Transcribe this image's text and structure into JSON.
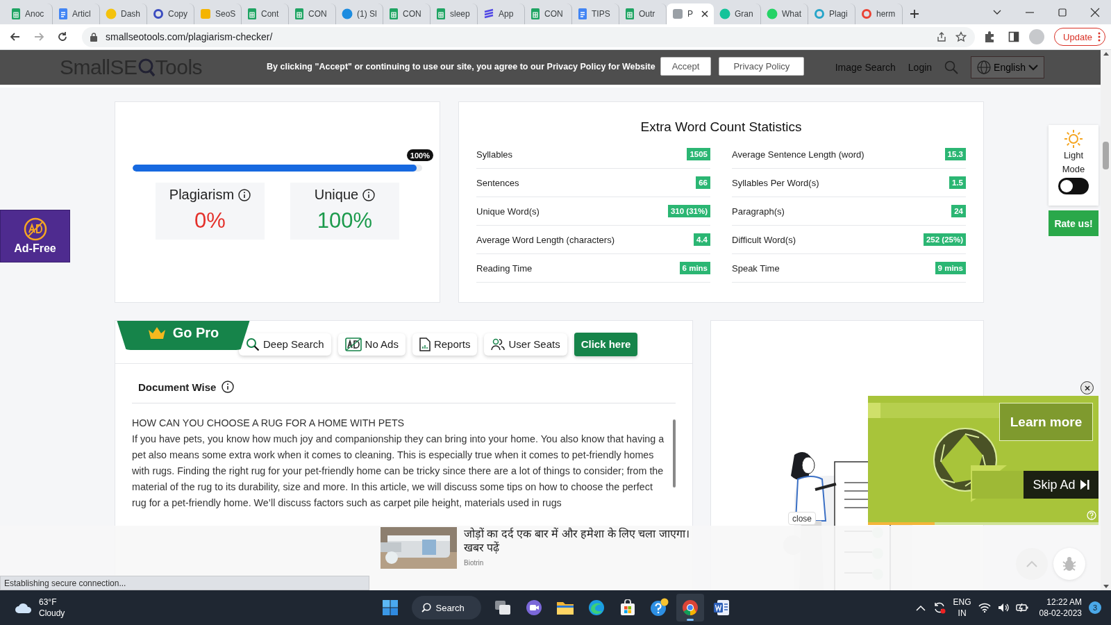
{
  "browser": {
    "tabs": [
      {
        "title": "Anoc",
        "kind": "sheet",
        "color": "#1fa463",
        "selected": false
      },
      {
        "title": "Articl",
        "kind": "doc",
        "color": "#4285f4",
        "selected": false
      },
      {
        "title": "Dash",
        "kind": "round",
        "color": "#f4c20d",
        "selected": false
      },
      {
        "title": "Copy",
        "kind": "ring",
        "color": "#3b4cc0",
        "selected": false
      },
      {
        "title": "SeoS",
        "kind": "square",
        "color": "#f4b400",
        "selected": false
      },
      {
        "title": "Cont",
        "kind": "sheet",
        "color": "#1fa463",
        "selected": false
      },
      {
        "title": "CON",
        "kind": "sheet",
        "color": "#1fa463",
        "selected": false
      },
      {
        "title": "(1) Sl",
        "kind": "round",
        "color": "#1d8ce0",
        "selected": false
      },
      {
        "title": "CON",
        "kind": "sheet",
        "color": "#1fa463",
        "selected": false
      },
      {
        "title": "sleep",
        "kind": "sheet",
        "color": "#1fa463",
        "selected": false
      },
      {
        "title": "App",
        "kind": "stripes",
        "color": "#4f46e5",
        "selected": false
      },
      {
        "title": "CON",
        "kind": "sheet",
        "color": "#1fa463",
        "selected": false
      },
      {
        "title": "TIPS",
        "kind": "doc",
        "color": "#4285f4",
        "selected": false
      },
      {
        "title": "Outr",
        "kind": "sheet",
        "color": "#1fa463",
        "selected": false
      },
      {
        "title": "P",
        "kind": "square",
        "color": "#9aa0a6",
        "selected": true
      },
      {
        "title": "Gran",
        "kind": "round",
        "color": "#15c39a",
        "selected": false
      },
      {
        "title": "What",
        "kind": "round",
        "color": "#25d366",
        "selected": false
      },
      {
        "title": "Plagi",
        "kind": "ring",
        "color": "#26a5c9",
        "selected": false
      },
      {
        "title": "herm",
        "kind": "ring",
        "color": "#ea4335",
        "selected": false
      }
    ],
    "url": "smallseotools.com/plagiarism-checker/",
    "update_button": "Update"
  },
  "header": {
    "logo": {
      "before_icon": "SmallSE",
      "after_icon": "Tools"
    },
    "nav": [
      "Image Search",
      "Login"
    ],
    "language": "English"
  },
  "cookie_banner": {
    "message": "By clicking \"Accept\" or continuing to use our site, you agree to our Privacy Policy for Website",
    "buttons": [
      "Accept",
      "Privacy Policy"
    ]
  },
  "ad_free": "Ad-Free",
  "theme_panel": {
    "label": "Light Mode",
    "on": false
  },
  "rate_button": "Rate us!",
  "score_card": {
    "level": 0.98,
    "badge": "100%",
    "plagiarism": {
      "label": "Plagiarism",
      "value": "0%"
    },
    "unique": {
      "label": "Unique",
      "value": "100%"
    }
  },
  "stats": {
    "title": "Extra Word Count Statistics",
    "columns": [
      [
        {
          "label": "Syllables",
          "value": "1505"
        },
        {
          "label": "Sentences",
          "value": "66"
        },
        {
          "label": "Unique Word(s)",
          "value": "310 (31%)"
        },
        {
          "label": "Average Word Length (characters)",
          "value": "4.4"
        },
        {
          "label": "Reading Time",
          "value": "6 mins"
        }
      ],
      [
        {
          "label": "Average Sentence Length (word)",
          "value": "15.3"
        },
        {
          "label": "Syllables Per Word(s)",
          "value": "1.5"
        },
        {
          "label": "Paragraph(s)",
          "value": "24"
        },
        {
          "label": "Difficult Word(s)",
          "value": "252 (25%)"
        },
        {
          "label": "Speak Time",
          "value": "9 mins"
        }
      ]
    ]
  },
  "pro_bar": {
    "ribbon": "Go Pro",
    "features": [
      {
        "label": "Deep Search",
        "kind": "search"
      },
      {
        "label": "No Ads",
        "kind": "ad"
      },
      {
        "label": "Reports",
        "kind": "report"
      },
      {
        "label": "User Seats",
        "kind": "users"
      }
    ],
    "button": "Click here"
  },
  "document": {
    "title": "Document Wise",
    "heading": "HOW CAN YOU CHOOSE A RUG FOR A HOME WITH PETS",
    "paragraph": "If you have pets, you know how much joy and companionship they can bring into your home. You also know that having a pet also means some extra work when it comes to cleaning. This is especially true when it comes to pet-friendly homes with rugs. Finding the right rug for your pet-friendly home can be tricky since there are a lot of things to consider; from the material of the rug to its durability, size and more. In this article, we will discuss some tips on how to choose the perfect rug for a pet-friendly home. We’ll discuss factors such as carpet pile height, materials used in rugs"
  },
  "close_label": "close",
  "video_ad": {
    "learn_more": "Learn more",
    "skip": "Skip Ad",
    "progress": {
      "level": 0.29
    }
  },
  "native_ad": {
    "headline": "जोड़ों का दर्द एक बार में और हमेशा के लिए चला जाएगा। खबर पढ़ें",
    "source": "Biotrin"
  },
  "status_bubble": "Establishing secure connection...",
  "taskbar": {
    "weather": {
      "temp": "63°F",
      "condition": "Cloudy"
    },
    "search": "Search",
    "apps": [
      {
        "kind": "taskview",
        "active": false
      },
      {
        "kind": "chat",
        "active": false
      },
      {
        "kind": "folder",
        "active": false
      },
      {
        "kind": "edge",
        "active": false
      },
      {
        "kind": "store",
        "active": false
      },
      {
        "kind": "tips",
        "active": false
      },
      {
        "kind": "chrome",
        "active": true
      },
      {
        "kind": "word",
        "active": false
      }
    ],
    "language": {
      "top": "ENG",
      "bottom": "IN"
    },
    "time": "12:22 AM",
    "date": "08-02-2023",
    "notifications": "3"
  }
}
